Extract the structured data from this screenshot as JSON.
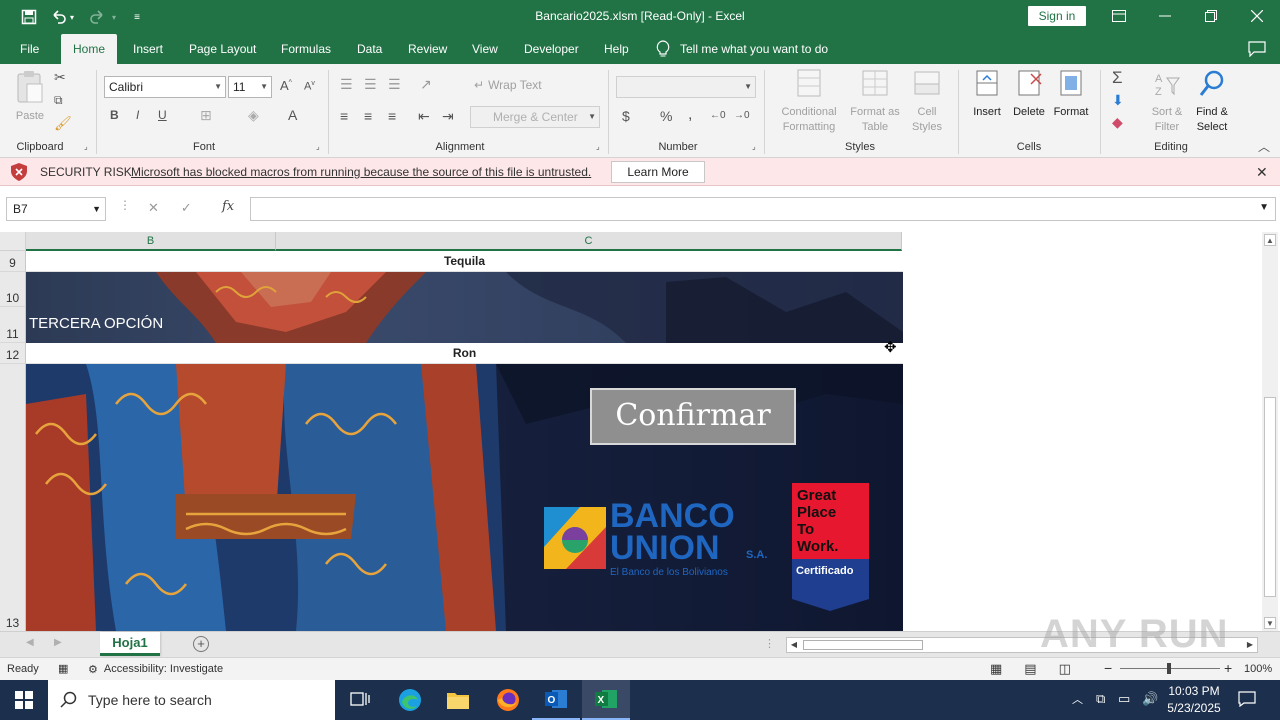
{
  "window": {
    "title": "Bancario2025.xlsm  [Read-Only]  -  Excel",
    "sign_in": "Sign in"
  },
  "ribbon_tabs": [
    "File",
    "Home",
    "Insert",
    "Page Layout",
    "Formulas",
    "Data",
    "Review",
    "View",
    "Developer",
    "Help"
  ],
  "active_tab": "Home",
  "tell_me": "Tell me what you want to do",
  "ribbon": {
    "clipboard": {
      "paste": "Paste",
      "group": "Clipboard"
    },
    "font": {
      "name": "Calibri",
      "size": "11",
      "group": "Font",
      "bold": "B",
      "italic": "I",
      "underline": "U"
    },
    "alignment": {
      "wrap_text": "Wrap Text",
      "merge_center": "Merge & Center",
      "group": "Alignment"
    },
    "number": {
      "format": "",
      "group": "Number",
      "currency": "$",
      "percent": "%",
      "comma": ","
    },
    "styles": {
      "conditional_line1": "Conditional",
      "conditional_line2": "Formatting",
      "format_table_line1": "Format as",
      "format_table_line2": "Table",
      "cell_styles_line1": "Cell",
      "cell_styles_line2": "Styles",
      "group": "Styles"
    },
    "cells": {
      "insert": "Insert",
      "delete": "Delete",
      "format": "Format",
      "group": "Cells"
    },
    "editing": {
      "sort_line1": "Sort &",
      "sort_line2": "Filter",
      "find_line1": "Find &",
      "find_line2": "Select",
      "group": "Editing"
    }
  },
  "security_bar": {
    "label": "SECURITY RISK",
    "message": "Microsoft has blocked macros from running because the source of this file is untrusted.",
    "button": "Learn More"
  },
  "formula_bar": {
    "name_box": "B7",
    "fx": "fx",
    "formula": ""
  },
  "sheet": {
    "columns": [
      "B",
      "C"
    ],
    "rows": [
      {
        "num": "9",
        "text": "Tequila"
      },
      {
        "num": "10",
        "text": ""
      },
      {
        "num": "11",
        "text": ""
      },
      {
        "num": "12",
        "text": "Ron"
      },
      {
        "num": "13",
        "text": ""
      }
    ],
    "banner_text": "TERCERA OPCIÓN",
    "confirm_button": "Confirmar",
    "bank_logo": {
      "line1": "BANCO",
      "line2": "UNION",
      "suffix": "S.A.",
      "tagline": "El Banco de los Bolivianos"
    },
    "gptw_badge": {
      "l1": "Great",
      "l2": "Place",
      "l3": "To",
      "l4": "Work.",
      "cert": "Certificado"
    }
  },
  "sheet_tabs": [
    "Hoja1"
  ],
  "status_bar": {
    "ready": "Ready",
    "accessibility": "Accessibility: Investigate",
    "zoom": "100%"
  },
  "taskbar": {
    "search_placeholder": "Type here to search",
    "time": "10:03 PM",
    "date": "5/23/2025"
  },
  "watermark": "ANY RUN",
  "colors": {
    "excel_green": "#217346",
    "security_bg": "#fde7e9",
    "taskbar": "#1c2f4c"
  }
}
